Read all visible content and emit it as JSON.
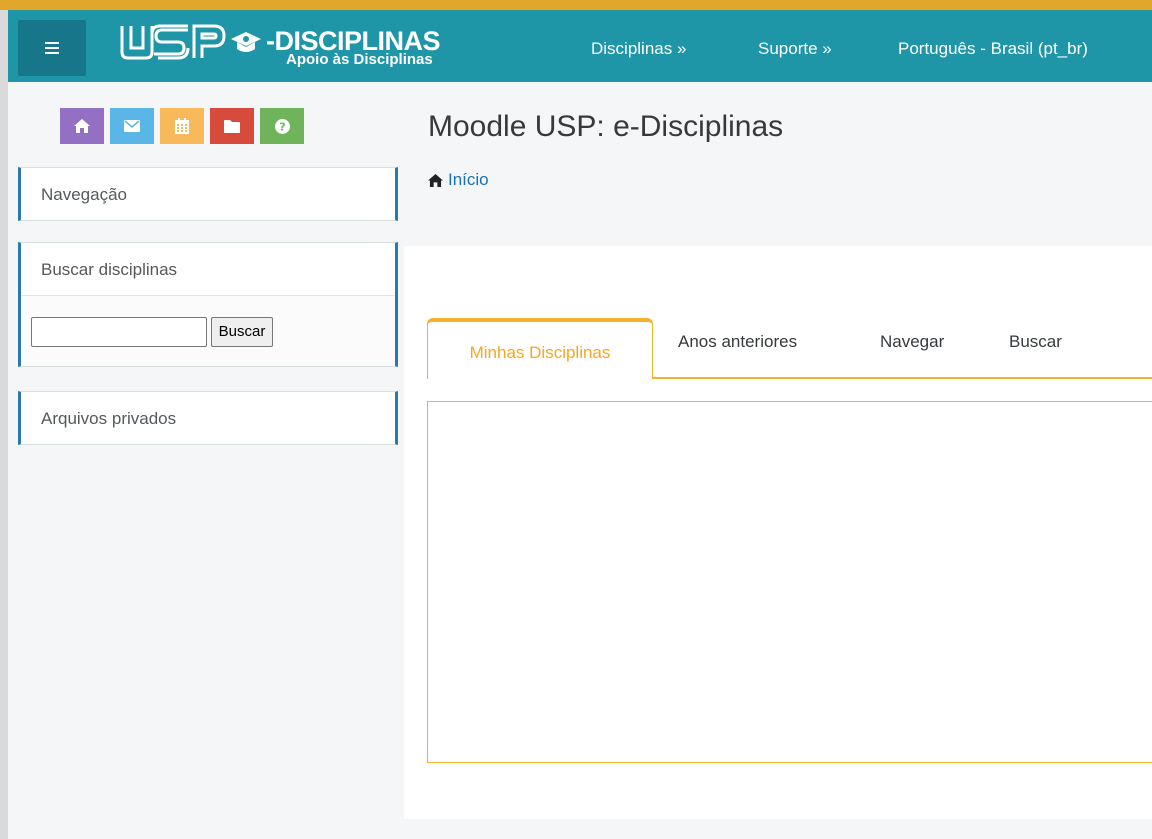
{
  "navbar": {
    "brand_title": "-DISCIPLINAS",
    "brand_subtitle": "Apoio às Disciplinas",
    "logo_text": "USP",
    "items": [
      {
        "label": "Disciplinas »"
      },
      {
        "label": "Suporte »"
      },
      {
        "label": "Português - Brasil (pt_br)"
      }
    ]
  },
  "quick_links": [
    {
      "icon": "home-icon",
      "color": "#9370c4"
    },
    {
      "icon": "envelope-icon",
      "color": "#5bb6e8"
    },
    {
      "icon": "calendar-icon",
      "color": "#f7b95a"
    },
    {
      "icon": "folder-icon",
      "color": "#d64b3b"
    },
    {
      "icon": "question-icon",
      "color": "#6fb45a"
    }
  ],
  "sidebar": {
    "navigation_title": "Navegação",
    "search_title": "Buscar disciplinas",
    "search_value": "",
    "search_button": "Buscar",
    "private_files_title": "Arquivos privados"
  },
  "page": {
    "title": "Moodle USP: e-Disciplinas",
    "breadcrumb": "Início"
  },
  "tabs": [
    {
      "label": "Minhas Disciplinas",
      "active": true
    },
    {
      "label": "Anos anteriores"
    },
    {
      "label": "Navegar"
    },
    {
      "label": "Buscar"
    }
  ],
  "colors": {
    "navbar": "#1e96a8",
    "accent": "#f5b12a",
    "link": "#1b6fb5"
  }
}
